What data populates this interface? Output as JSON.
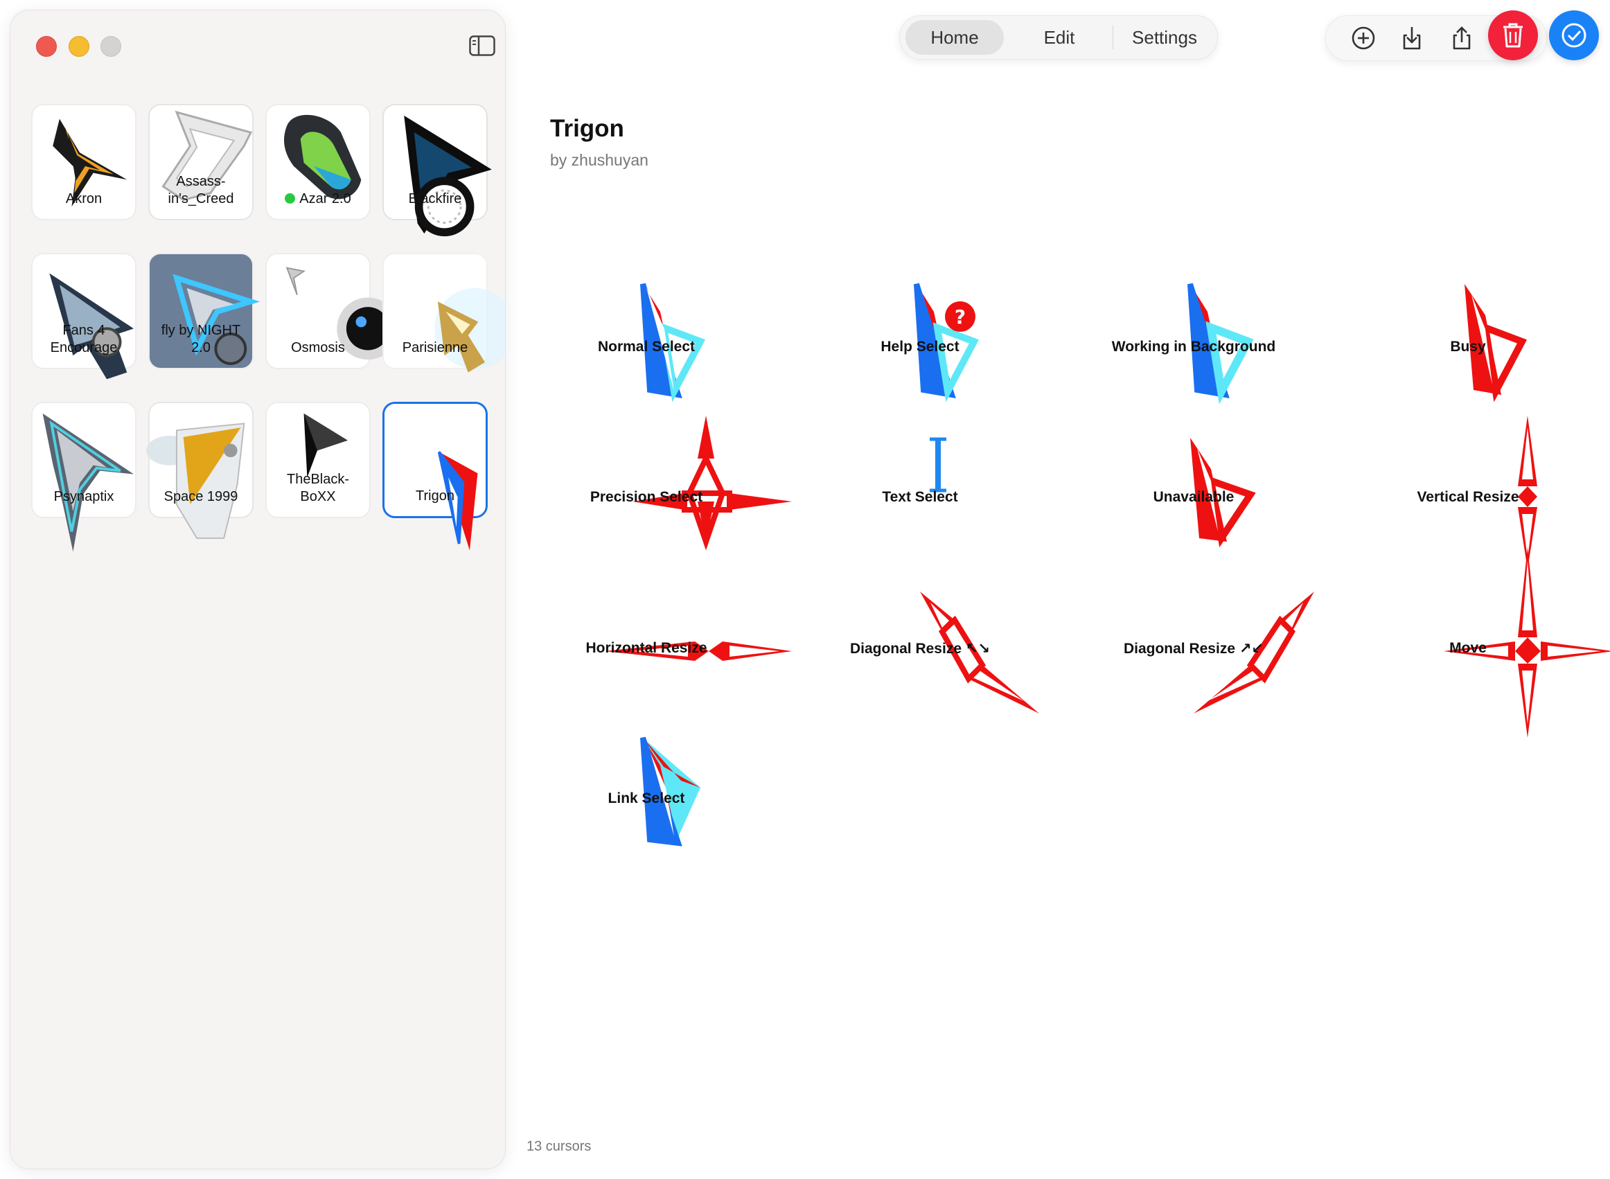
{
  "window": {
    "sidebar": {
      "themes": [
        {
          "name": "Akron"
        },
        {
          "name": "Assass-\nin's_Creed"
        },
        {
          "name": "Azar 2.0",
          "status": "active-dot"
        },
        {
          "name": "Blackfire"
        },
        {
          "name": "Fans 4\nEncourage"
        },
        {
          "name": "fly by NIGHT\n2.0"
        },
        {
          "name": "Osmosis"
        },
        {
          "name": "Parisienne"
        },
        {
          "name": "Psynaptix"
        },
        {
          "name": "Space 1999"
        },
        {
          "name": "TheBlack-\nBoXX"
        },
        {
          "name": "Trigon",
          "selected": true
        }
      ]
    }
  },
  "toolbar": {
    "segments": [
      {
        "label": "Home",
        "active": true
      },
      {
        "label": "Edit"
      },
      {
        "label": "Settings"
      }
    ],
    "actions": [
      "add-icon",
      "import-icon",
      "share-icon"
    ],
    "delete": "trash-icon",
    "confirm": "checkmark-icon"
  },
  "theme_detail": {
    "title": "Trigon",
    "author": "by zhushuyan",
    "cursors": [
      {
        "label": "Normal Select"
      },
      {
        "label": "Help Select"
      },
      {
        "label": "Working in Background"
      },
      {
        "label": "Busy"
      },
      {
        "label": "Precision Select"
      },
      {
        "label": "Text Select"
      },
      {
        "label": "Unavailable"
      },
      {
        "label": "Vertical Resize"
      },
      {
        "label": "Horizontal Resize"
      },
      {
        "label": "Diagonal Resize ↖↘"
      },
      {
        "label": "Diagonal Resize ↗↙"
      },
      {
        "label": "Move"
      },
      {
        "label": "Link Select"
      }
    ],
    "count_text": "13 cursors"
  },
  "colors": {
    "accent_blue": "#1a82f7",
    "delete_red": "#f1223a",
    "cursor_red": "#ee1111",
    "cursor_blue": "#1a6ff0",
    "cursor_cyan": "#5ee8f7"
  }
}
